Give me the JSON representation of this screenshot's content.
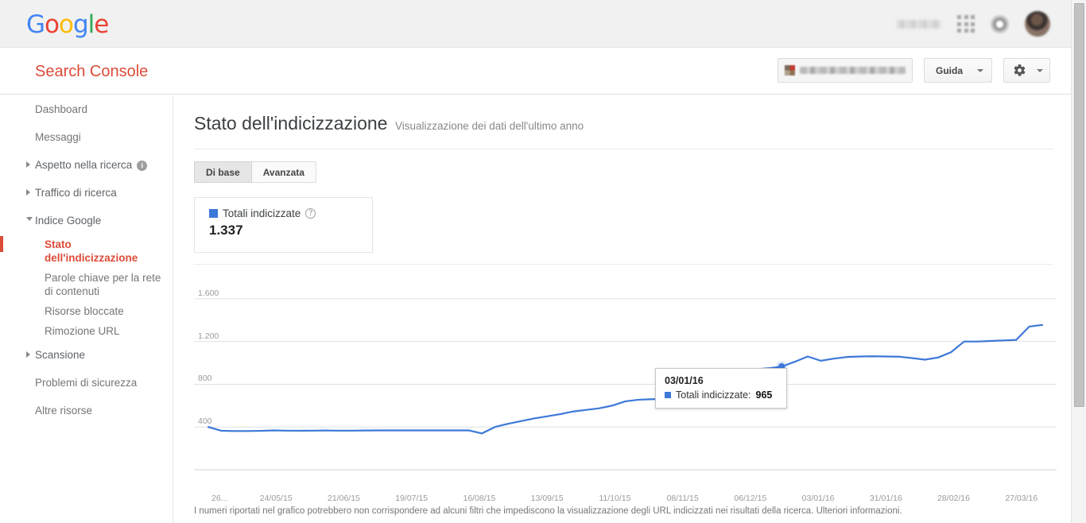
{
  "colors": {
    "accent_red": "#dd4b39",
    "line_blue": "#3c78d8",
    "legend_blue": "#3c78d8",
    "google_blue": "#4285f4",
    "google_red": "#ea4335",
    "google_yellow": "#fbbc05",
    "google_green": "#34a853"
  },
  "gbar": {
    "logo": [
      "G",
      "o",
      "o",
      "g",
      "l",
      "e"
    ],
    "icons": {
      "user_name_blurred": "",
      "apps": "apps-grid-icon",
      "notifications": "bell-icon",
      "avatar": "avatar"
    }
  },
  "product_bar": {
    "title": "Search Console",
    "site_selector_value": "",
    "help_button": "Guida",
    "settings_button": "gear-icon"
  },
  "sidebar": {
    "items": [
      {
        "label": "Dashboard",
        "type": "link",
        "active": false
      },
      {
        "label": "Messaggi",
        "type": "link",
        "active": false
      },
      {
        "label": "Aspetto nella ricerca",
        "type": "group",
        "expanded": false,
        "info": "i"
      },
      {
        "label": "Traffico di ricerca",
        "type": "group",
        "expanded": false
      },
      {
        "label": "Indice Google",
        "type": "group",
        "expanded": true
      },
      {
        "label": "Stato dell'indicizzazione",
        "type": "sub",
        "active": true
      },
      {
        "label": "Parole chiave per la rete di contenuti",
        "type": "sub",
        "active": false
      },
      {
        "label": "Risorse bloccate",
        "type": "sub",
        "active": false
      },
      {
        "label": "Rimozione URL",
        "type": "sub",
        "active": false
      },
      {
        "label": "Scansione",
        "type": "group",
        "expanded": false
      },
      {
        "label": "Problemi di sicurezza",
        "type": "link",
        "active": false
      },
      {
        "label": "Altre risorse",
        "type": "link",
        "active": false
      }
    ]
  },
  "main": {
    "title": "Stato dell'indicizzazione",
    "subtitle": "Visualizzazione dei dati dell'ultimo anno",
    "tabs": [
      {
        "label": "Di base",
        "selected": true
      },
      {
        "label": "Avanzata",
        "selected": false
      }
    ],
    "stat_card": {
      "legend_label": "Totali indicizzate",
      "help_icon": "?",
      "value": "1.337"
    },
    "tooltip": {
      "date": "03/01/16",
      "series_label": "Totali indicizzate:",
      "value": "965"
    },
    "footnote": "I numeri riportati nel grafico potrebbero non corrispondere ad alcuni filtri che impediscono la visualizzazione degli URL indicizzati nei risultati della ricerca.",
    "footnote_link": "Ulteriori informazioni."
  },
  "chart_data": {
    "type": "line",
    "title": "Stato dell'indicizzazione",
    "series": [
      {
        "name": "Totali indicizzate",
        "color": "#3c78d8",
        "values": [
          400,
          365,
          362,
          362,
          364,
          368,
          366,
          365,
          366,
          367,
          366,
          366,
          367,
          368,
          368,
          368,
          368,
          368,
          368,
          368,
          368,
          340,
          400,
          430,
          455,
          480,
          500,
          520,
          545,
          560,
          575,
          600,
          640,
          655,
          660,
          660,
          665,
          668,
          665,
          660,
          660,
          920,
          940,
          950,
          965,
          1010,
          1060,
          1020,
          1040,
          1055,
          1060,
          1062,
          1060,
          1058,
          1045,
          1030,
          1050,
          1100,
          1200,
          1200,
          1205,
          1210,
          1215,
          1340,
          1355
        ]
      }
    ],
    "xlabel": "",
    "ylabel": "",
    "ylim": [
      0,
      1800
    ],
    "yticks": [
      400,
      800,
      1200,
      1600
    ],
    "ytick_labels": [
      "400",
      "800",
      "1.200",
      "1.600"
    ],
    "xtick_labels": [
      "26...",
      "24/05/15",
      "21/06/15",
      "19/07/15",
      "16/08/15",
      "13/09/15",
      "11/10/15",
      "08/11/15",
      "06/12/15",
      "03/01/16",
      "31/01/16",
      "28/02/16",
      "27/03/16"
    ],
    "grid": true,
    "legend": "top-left",
    "highlight_point": {
      "x_label": "03/01/16",
      "value": 965
    }
  }
}
